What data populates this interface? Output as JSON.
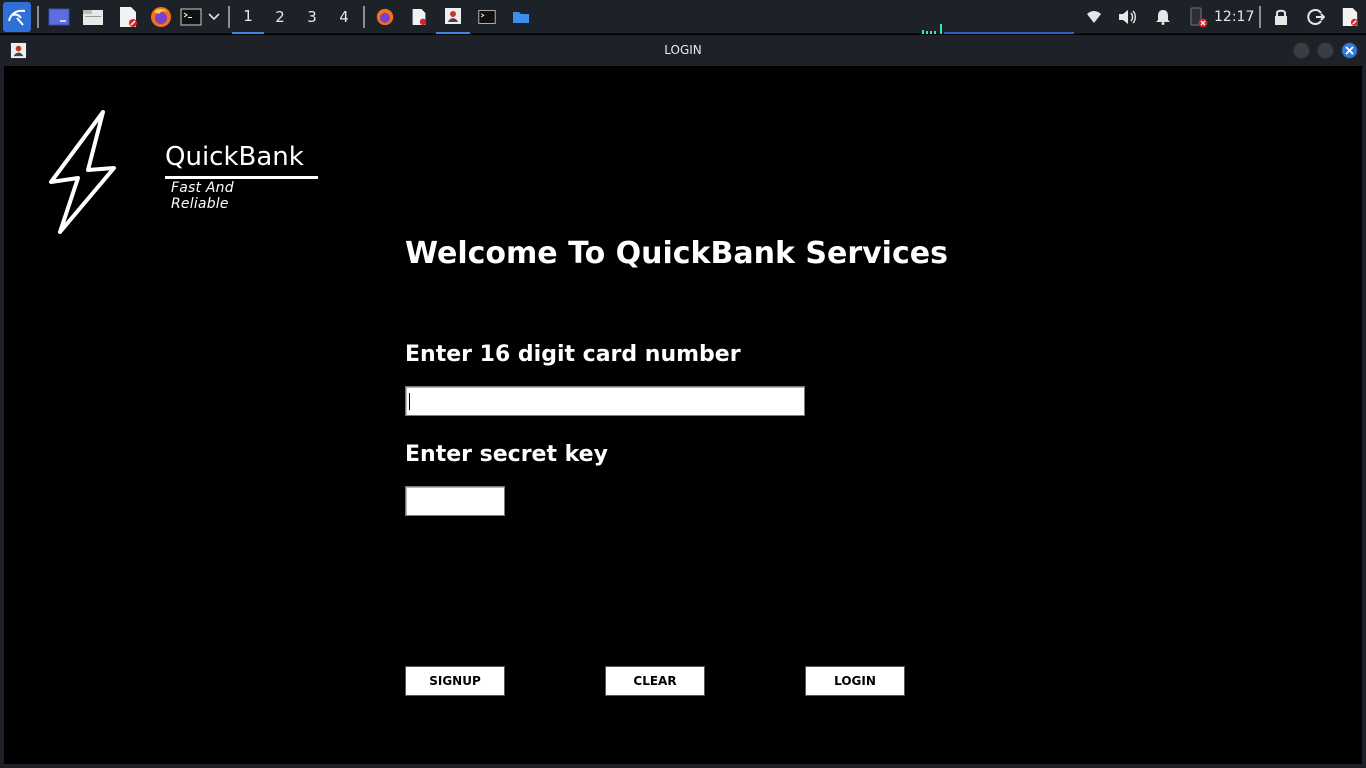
{
  "taskbar": {
    "workspaces": [
      "1",
      "2",
      "3",
      "4"
    ],
    "clock": "12:17",
    "icons": [
      "kali-menu-icon",
      "desktop-icon",
      "file-manager-icon",
      "text-editor-icon",
      "firefox-icon",
      "terminal-icon",
      "dropdown-chevron-icon",
      "wifi-icon",
      "volume-icon",
      "notification-bell-icon",
      "battery-icon",
      "lock-icon",
      "logout-icon"
    ]
  },
  "window": {
    "title": "LOGIN"
  },
  "logo": {
    "name": "QuickBank",
    "tagline": "Fast And Reliable"
  },
  "form": {
    "welcome": "Welcome To QuickBank Services",
    "card_label": "Enter 16 digit card number",
    "card_value": "",
    "key_label": "Enter secret key",
    "key_value": ""
  },
  "buttons": {
    "signup": "SIGNUP",
    "clear": "CLEAR",
    "login": "LOGIN"
  },
  "colors": {
    "accent": "#3c86e6",
    "background": "#000000",
    "taskbar": "#1d2229"
  }
}
